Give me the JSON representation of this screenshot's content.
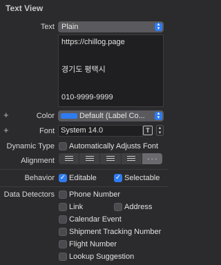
{
  "section_title": "Text View",
  "text": {
    "label": "Text",
    "value": "Plain",
    "content_lines": [
      "https://chillog.page",
      "",
      "경기도 평택시",
      "",
      "010-9999-9999"
    ]
  },
  "color": {
    "label": "Color",
    "value": "Default (Label Co...",
    "swatch": "#2f7bf0"
  },
  "font": {
    "label": "Font",
    "value": "System 14.0"
  },
  "dynamic_type": {
    "label": "Dynamic Type",
    "option": "Automatically Adjusts Font"
  },
  "alignment": {
    "label": "Alignment",
    "options": [
      "left",
      "center",
      "right",
      "justified",
      "natural"
    ],
    "selected": "natural"
  },
  "behavior": {
    "label": "Behavior",
    "editable": {
      "label": "Editable",
      "checked": true
    },
    "selectable": {
      "label": "Selectable",
      "checked": true
    }
  },
  "data_detectors": {
    "label": "Data Detectors",
    "phone_number": "Phone Number",
    "link": "Link",
    "address": "Address",
    "calendar_event": "Calendar Event",
    "shipment_tracking": "Shipment Tracking Number",
    "flight_number": "Flight Number",
    "lookup_suggestion": "Lookup Suggestion"
  },
  "plus_symbol": "+",
  "checkmark": "✓"
}
